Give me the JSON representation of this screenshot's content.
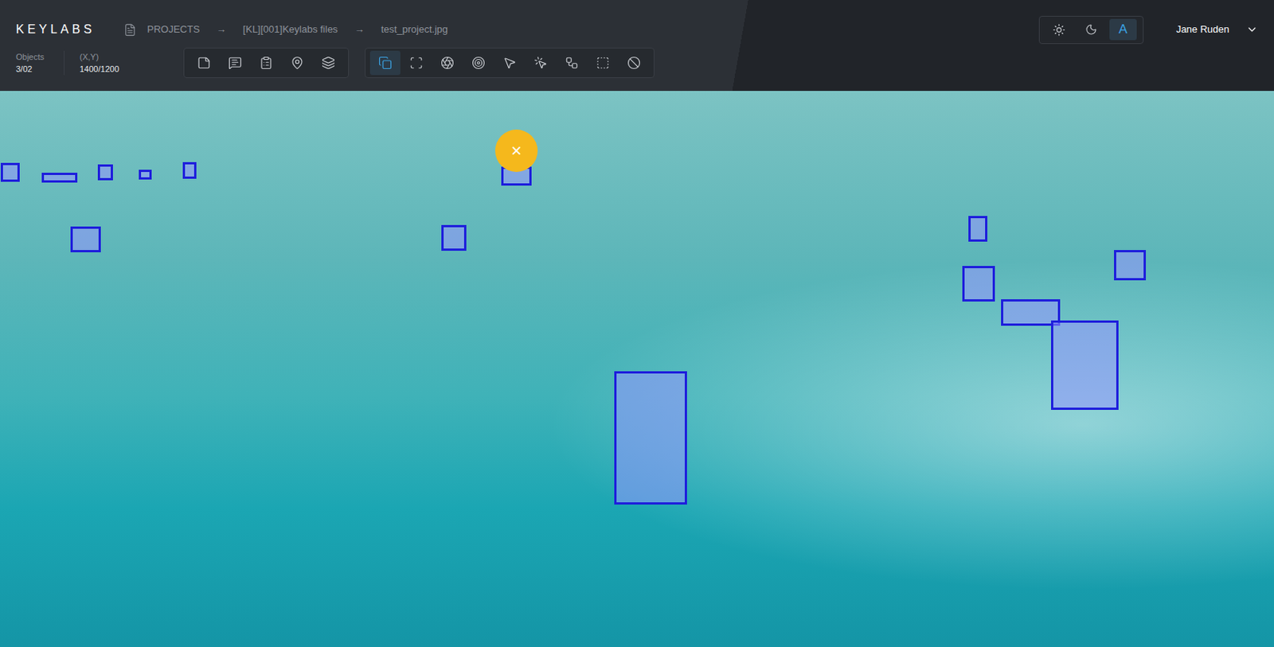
{
  "logo": "KEYLABS",
  "breadcrumb": {
    "items": [
      "PROJECTS",
      "[KL][001]Keylabs files",
      "test_project.jpg"
    ],
    "separator": "→"
  },
  "stats": [
    {
      "label": "Objects",
      "value": "3/02"
    },
    {
      "label": "(X,Y)",
      "value": "1400/1200"
    }
  ],
  "tool_groups": [
    [
      {
        "kind": "note",
        "selected": false
      },
      {
        "kind": "comment",
        "selected": false
      },
      {
        "kind": "list",
        "selected": false
      },
      {
        "kind": "pin",
        "selected": false
      },
      {
        "kind": "layers",
        "selected": false
      }
    ],
    [
      {
        "kind": "box",
        "selected": true
      },
      {
        "kind": "points",
        "selected": false
      },
      {
        "kind": "polygon",
        "selected": false
      },
      {
        "kind": "target",
        "selected": false
      },
      {
        "kind": "pointer",
        "selected": false
      },
      {
        "kind": "click",
        "selected": false
      },
      {
        "kind": "skeleton",
        "selected": false
      },
      {
        "kind": "selection",
        "selected": false
      },
      {
        "kind": "clear",
        "selected": false
      }
    ]
  ],
  "theme_options": [
    {
      "kind": "sun",
      "selected": false
    },
    {
      "kind": "moon",
      "selected": false
    },
    {
      "kind": "text",
      "label": "A",
      "selected": true
    }
  ],
  "user": {
    "name": "Jane Ruden"
  },
  "canvas": {
    "delete_button": "×"
  }
}
